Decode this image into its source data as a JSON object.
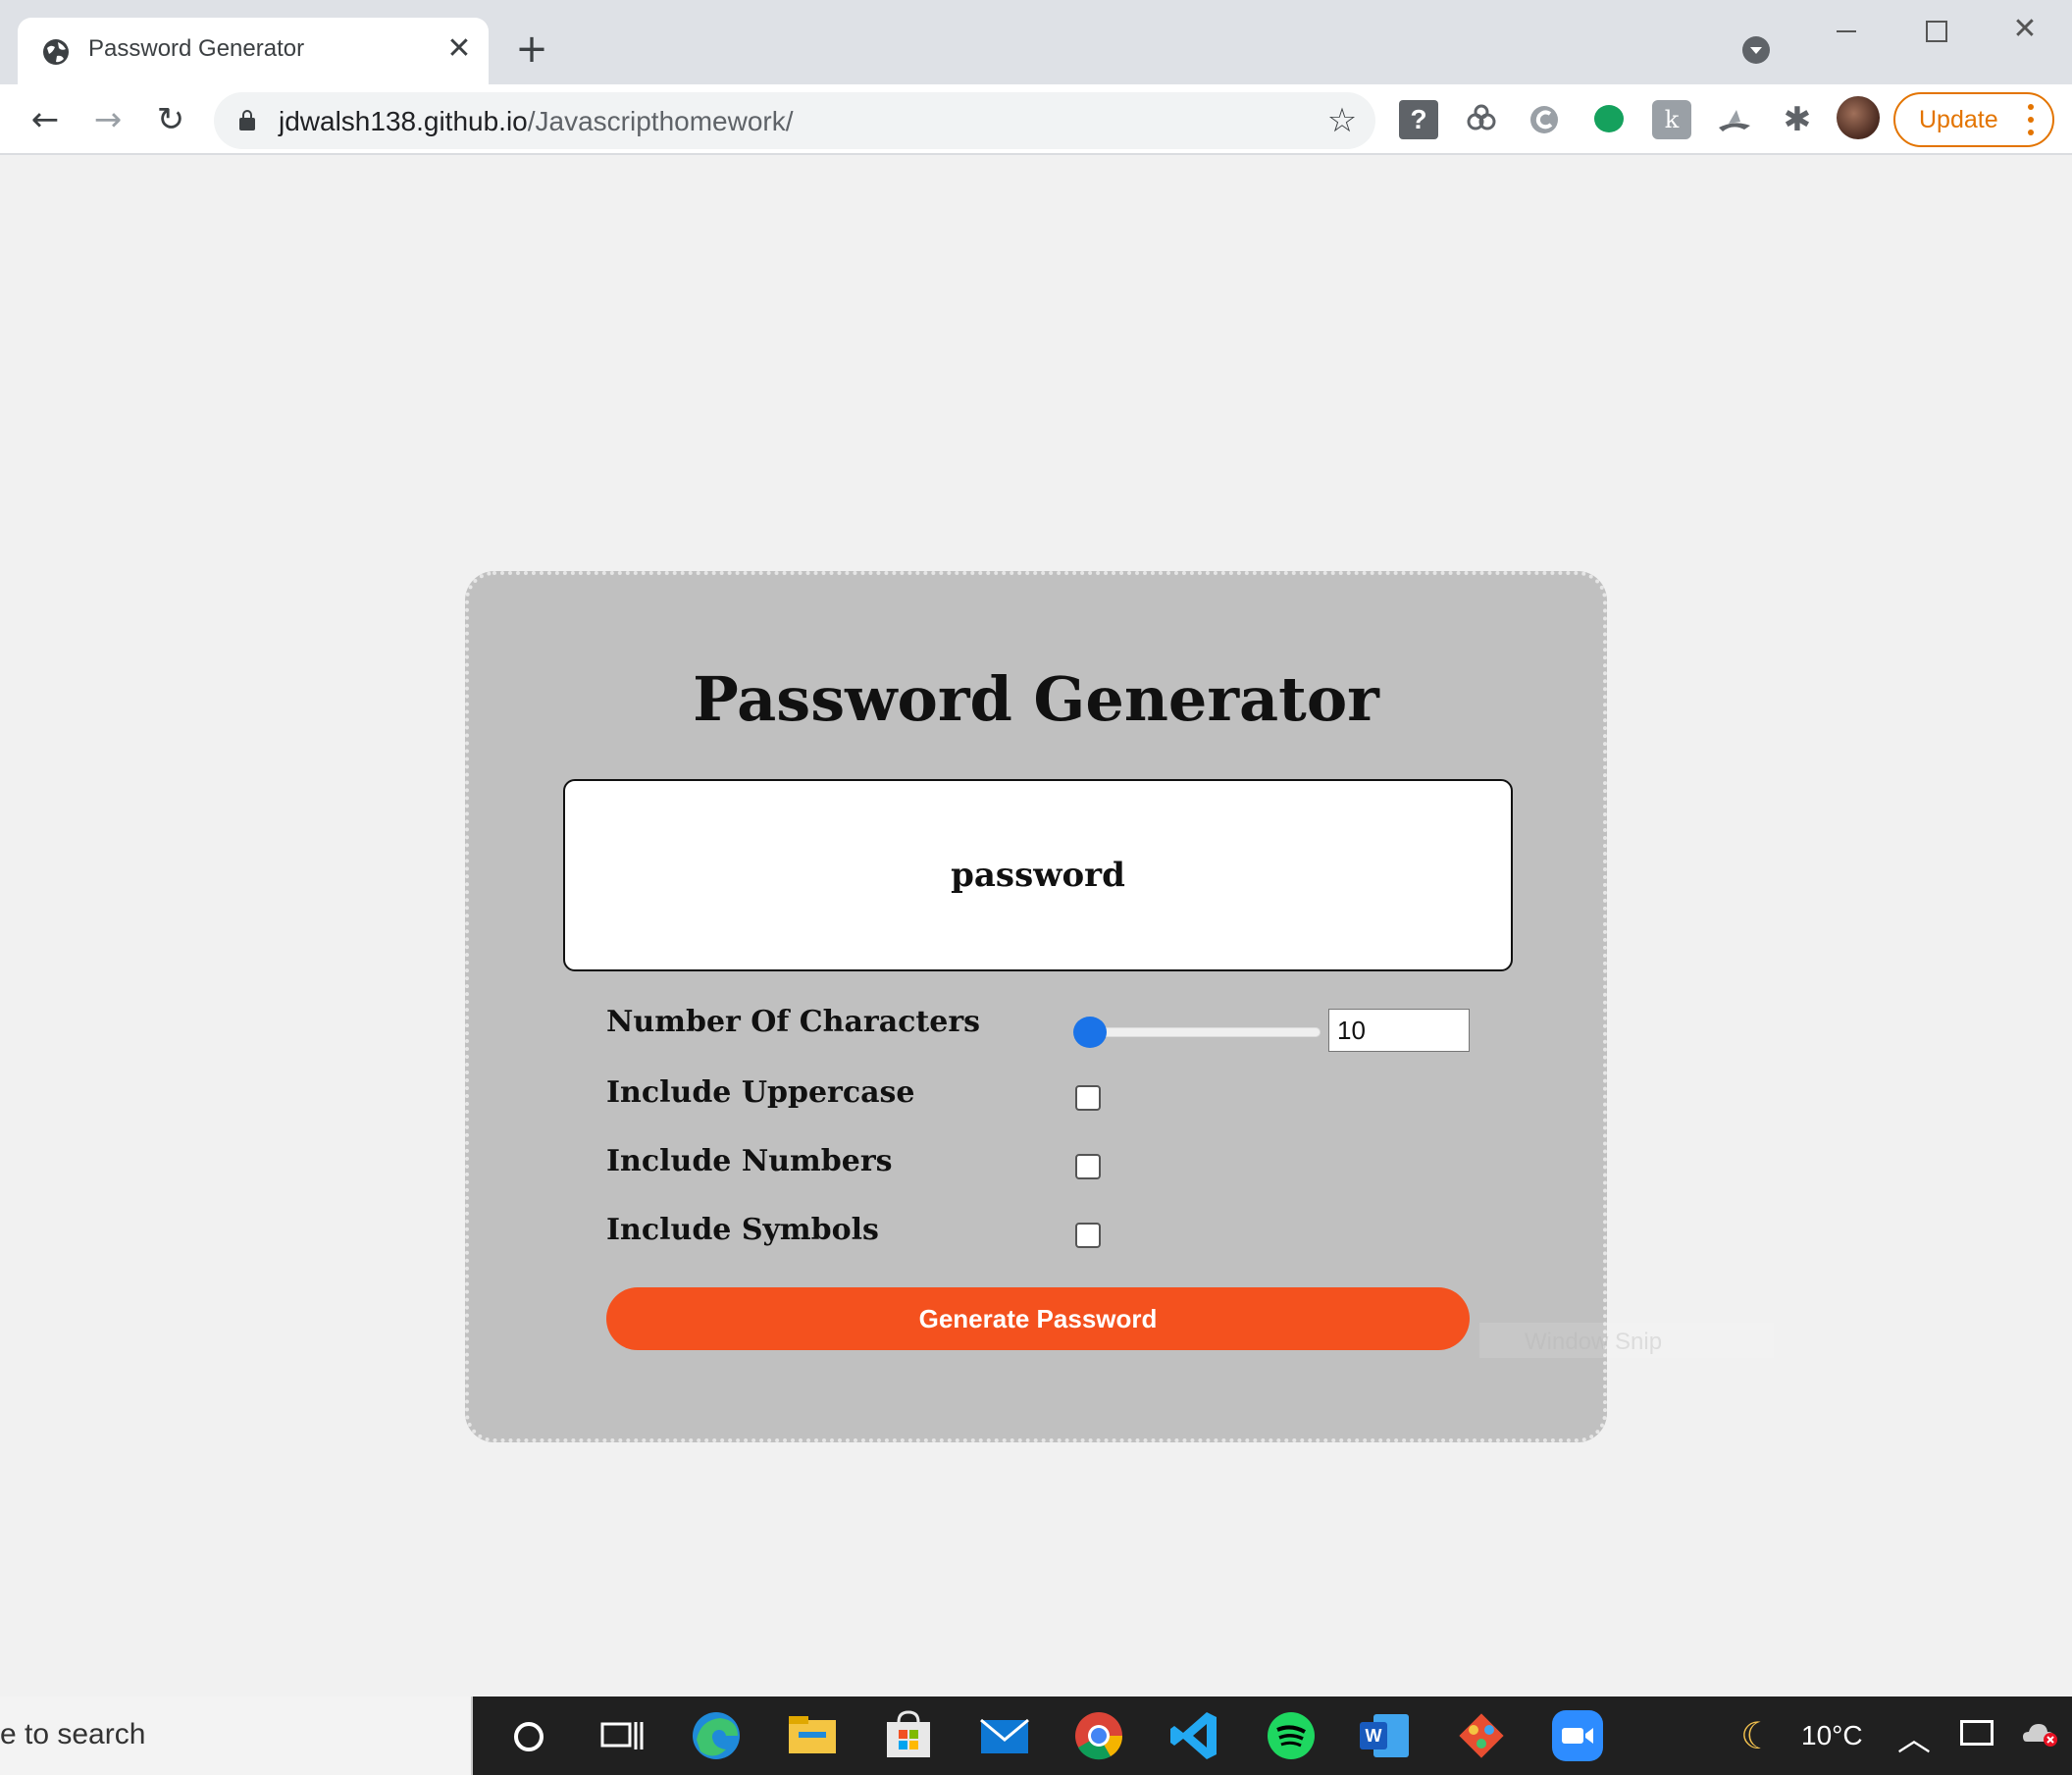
{
  "browser": {
    "tab_title": "Password Generator",
    "tab_close": "✕",
    "new_tab": "+",
    "url_host": "jdwalsh138.github.io",
    "url_path": "/Javascripthomework/",
    "update_label": "Update",
    "help_extension": "?",
    "k_extension": "k"
  },
  "page": {
    "title": "Password Generator",
    "password_display": "password",
    "options": {
      "characters_label": "Number Of Characters",
      "characters_value": "10",
      "characters_slider_level": 0,
      "uppercase_label": "Include Uppercase",
      "uppercase_checked": false,
      "numbers_label": "Include Numbers",
      "numbers_checked": false,
      "symbols_label": "Include Symbols",
      "symbols_checked": false
    },
    "generate_button": "Generate Password",
    "snip_overlay": "Window Snip"
  },
  "taskbar": {
    "search_text": "e to search",
    "weather_temp": "10°C",
    "apps": [
      "cortana",
      "task-view",
      "edge",
      "file-explorer",
      "microsoft-store",
      "mail",
      "chrome",
      "vscode",
      "spotify",
      "word",
      "git",
      "zoom"
    ]
  },
  "colors": {
    "accent_button": "#f4511e",
    "card_background": "#c0c0c0",
    "slider_thumb": "#1a73e8",
    "update_orange": "#e37400"
  }
}
